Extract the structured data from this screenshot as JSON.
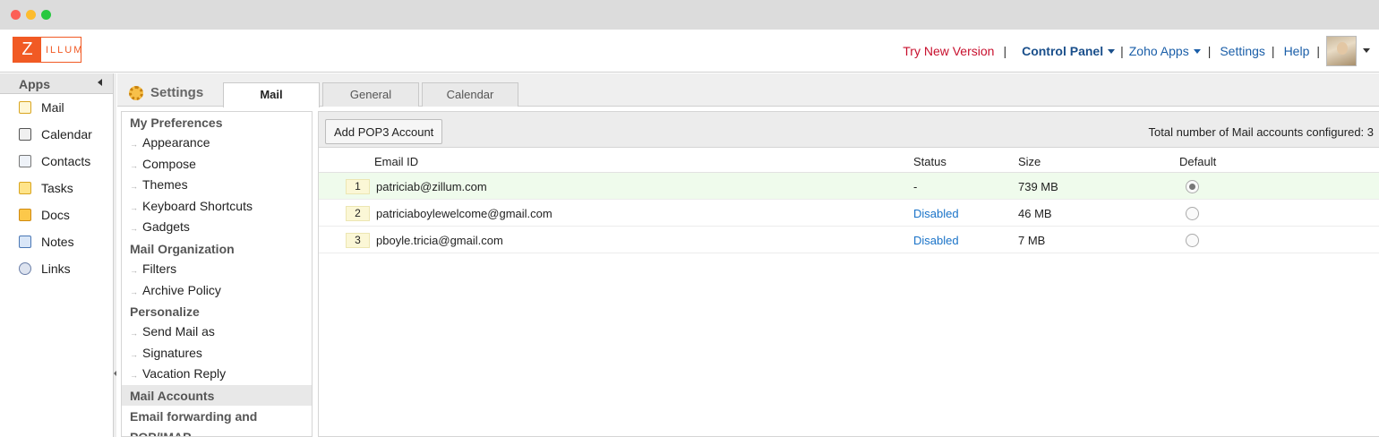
{
  "header": {
    "logo_letter": "Z",
    "logo_rest": "illum",
    "try_new_version": "Try New Version",
    "control_panel": "Control Panel",
    "zoho_apps": "Zoho Apps",
    "settings": "Settings",
    "help": "Help",
    "separator": "|"
  },
  "apps": {
    "title": "Apps",
    "items": [
      {
        "label": "Mail",
        "icon": "mail-icon"
      },
      {
        "label": "Calendar",
        "icon": "calendar-icon"
      },
      {
        "label": "Contacts",
        "icon": "contacts-icon"
      },
      {
        "label": "Tasks",
        "icon": "tasks-icon"
      },
      {
        "label": "Docs",
        "icon": "docs-icon"
      },
      {
        "label": "Notes",
        "icon": "notes-icon"
      },
      {
        "label": "Links",
        "icon": "links-icon"
      }
    ]
  },
  "settings": {
    "title": "Settings",
    "tabs": [
      "Mail",
      "General",
      "Calendar"
    ],
    "active_tab": "Mail"
  },
  "prefs": {
    "groups": [
      {
        "heading": "My Preferences",
        "items": [
          "Appearance",
          "Compose",
          "Themes",
          "Keyboard Shortcuts",
          "Gadgets"
        ]
      },
      {
        "heading": "Mail Organization",
        "items": [
          "Filters",
          "Archive Policy"
        ]
      },
      {
        "heading": "Personalize",
        "items": [
          "Send Mail as",
          "Signatures",
          "Vacation Reply"
        ]
      }
    ],
    "selected": "Mail Accounts",
    "after_selected": "Email forwarding and",
    "after_selected_cont": "POP/IMAP"
  },
  "accounts": {
    "add_button": "Add POP3 Account",
    "total_label": "Total number of Mail accounts configured: 3",
    "columns": {
      "email": "Email ID",
      "status": "Status",
      "size": "Size",
      "default": "Default"
    },
    "rows": [
      {
        "num": "1",
        "email": "patriciab@zillum.com",
        "status": "-",
        "size": "739 MB",
        "default": true
      },
      {
        "num": "2",
        "email": "patriciaboylewelcome@gmail.com",
        "status": "Disabled",
        "size": "46 MB",
        "default": false
      },
      {
        "num": "3",
        "email": "pboyle.tricia@gmail.com",
        "status": "Disabled",
        "size": "7 MB",
        "default": false
      }
    ]
  },
  "colors": {
    "brand": "#f15a24",
    "try_new_version": "#c8102e",
    "link": "#1a5ea8"
  }
}
